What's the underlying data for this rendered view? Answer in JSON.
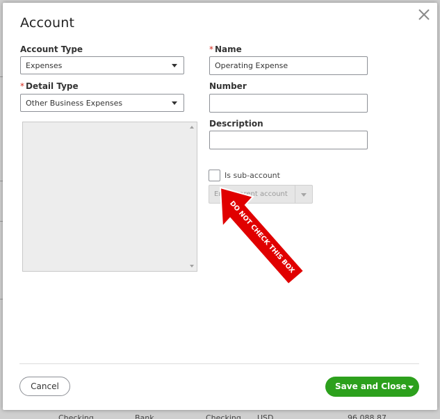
{
  "modal": {
    "title": "Account"
  },
  "form": {
    "account_type": {
      "label": "Account Type",
      "value": "Expenses"
    },
    "detail_type": {
      "label": "Detail Type",
      "required_mark": "*",
      "value": "Other Business Expenses"
    },
    "name": {
      "label": "Name",
      "required_mark": "*",
      "value": "Operating Expense"
    },
    "number": {
      "label": "Number",
      "value": ""
    },
    "description": {
      "label": "Description",
      "value": ""
    },
    "sub_account": {
      "label": "Is sub-account",
      "checked": false
    },
    "parent_account": {
      "placeholder": "Enter parent account"
    }
  },
  "annotation": {
    "text": "DO NOT CHECK THIS BOX",
    "color": "#e00000"
  },
  "footer": {
    "cancel_label": "Cancel",
    "save_label": "Save and Close"
  },
  "background_row": {
    "cells": [
      "Checking",
      "Bank",
      "Checking",
      "USD",
      "96,088.87"
    ]
  },
  "colors": {
    "primary_green": "#2ca01c",
    "required_red": "#d52b1e"
  }
}
